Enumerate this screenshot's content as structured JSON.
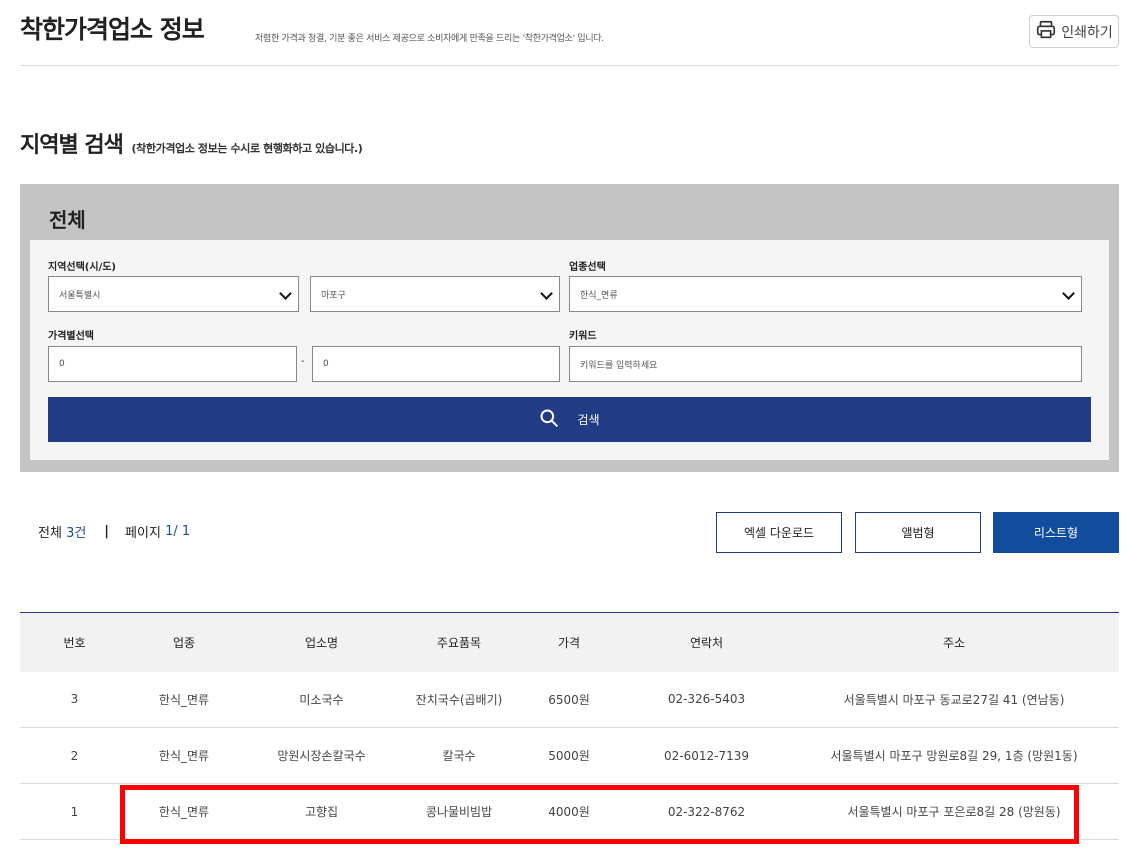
{
  "header": {
    "title": "착한가격업소 정보",
    "description": "저렴한 가격과 청결, 기분 좋은 서비스 제공으로 소비자에게 만족을 드리는 '착한가격업소' 입니다.",
    "print_label": "인쇄하기"
  },
  "section": {
    "title": "지역별 검색",
    "note": "(착한가격업소 정보는 수시로 현행화하고 있습니다.)"
  },
  "search": {
    "region_title": "전체",
    "region_label": "지역선택(시/도)",
    "sido_value": "서울특별시",
    "sigungu_value": "마포구",
    "category_label": "업종선택",
    "category_value": "한식_면류",
    "price_label": "가격별선택",
    "price_min": "0",
    "price_dash": "-",
    "price_max": "0",
    "keyword_label": "키워드",
    "keyword_placeholder": "키워드를 입력하세요",
    "button_label": "검색"
  },
  "summary": {
    "total_label": "전체",
    "total_count": "3건",
    "page_label": "페이지",
    "page_current": "1",
    "page_total": "/ 1"
  },
  "actions": {
    "excel": "엑셀 다운로드",
    "album": "앨범형",
    "list": "리스트형"
  },
  "table": {
    "headers": [
      "번호",
      "업종",
      "업소명",
      "주요품목",
      "가격",
      "연락처",
      "주소"
    ],
    "rows": [
      [
        "3",
        "한식_면류",
        "미소국수",
        "잔치국수(곱배기)",
        "6500원",
        "02-326-5403",
        "서울특별시 마포구 동교로27길 41 (연남동)"
      ],
      [
        "2",
        "한식_면류",
        "망원시장손칼국수",
        "칼국수",
        "5000원",
        "02-6012-7139",
        "서울특별시 마포구 망원로8길 29, 1층 (망원1동)"
      ],
      [
        "1",
        "한식_면류",
        "고향집",
        "콩나물비빔밥",
        "4000원",
        "02-322-8762",
        "서울특별시 마포구 포은로8길 28 (망원동)"
      ]
    ]
  },
  "colors": {
    "primary": "#223b85",
    "list_button": "#124d9d",
    "count_accent": "#1d4f9a",
    "highlight": "#ff0000"
  }
}
